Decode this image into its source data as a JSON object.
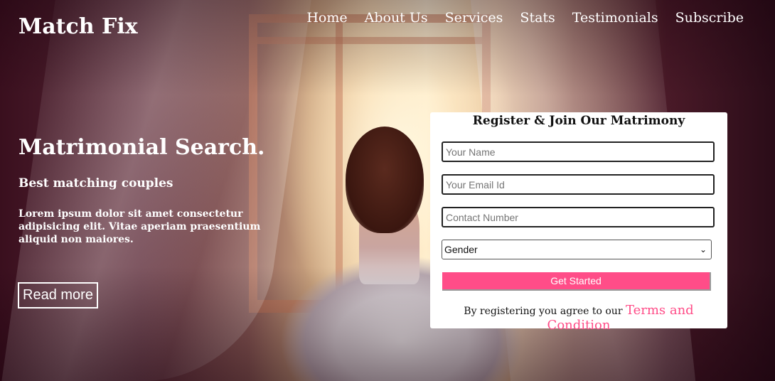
{
  "brand": {
    "name": "Match Fix"
  },
  "nav": {
    "items": [
      {
        "label": "Home"
      },
      {
        "label": "About Us"
      },
      {
        "label": "Services"
      },
      {
        "label": "Stats"
      },
      {
        "label": "Testimonials"
      },
      {
        "label": "Subscribe"
      }
    ]
  },
  "hero": {
    "title": "Matrimonial Search.",
    "subtitle": "Best matching couples",
    "text": "Lorem ipsum dolor sit amet consectetur adipisicing elit. Vitae aperiam praesentium aliquid non maiores.",
    "read_more_label": "Read more"
  },
  "register": {
    "title": "Register & Join Our Matrimony",
    "name_placeholder": "Your Name",
    "email_placeholder": "Your Email Id",
    "contact_placeholder": "Contact Number",
    "gender_selected": "Gender",
    "submit_label": "Get Started",
    "terms_prefix": "By registering you agree to our",
    "terms_link": "Terms and Condition"
  },
  "colors": {
    "accent": "#ff4d88",
    "text_light": "#ffffff"
  },
  "icons": {
    "select_chevron": "chevron-down-icon"
  }
}
